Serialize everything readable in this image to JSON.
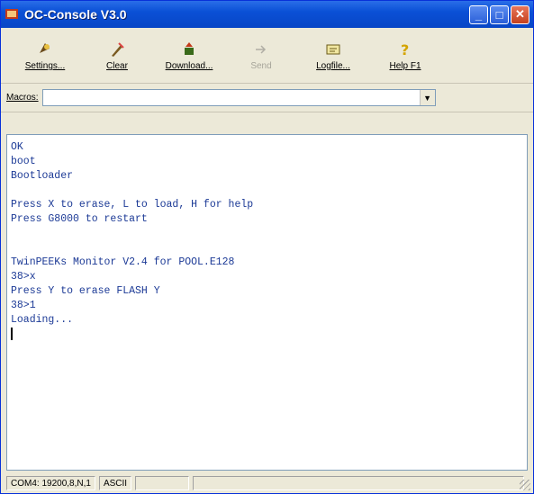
{
  "window": {
    "title": "OC-Console V3.0"
  },
  "toolbar": {
    "items": [
      {
        "label": "Settings...",
        "icon": "settings-icon",
        "enabled": true
      },
      {
        "label": "Clear",
        "icon": "clear-icon",
        "enabled": true
      },
      {
        "label": "Download...",
        "icon": "download-icon",
        "enabled": true
      },
      {
        "label": "Send",
        "icon": "send-icon",
        "enabled": false
      },
      {
        "label": "Logfile...",
        "icon": "logfile-icon",
        "enabled": true
      },
      {
        "label": "Help F1",
        "icon": "help-icon",
        "enabled": true
      }
    ]
  },
  "macros": {
    "label": "Macros:",
    "value": ""
  },
  "console": {
    "lines": [
      "OK",
      "boot",
      "Bootloader",
      "",
      "Press X to erase, L to load, H for help",
      "Press G8000 to restart",
      "",
      "",
      "TwinPEEKs Monitor V2.4 for POOL.E128",
      "38>x",
      "Press Y to erase FLASH Y",
      "38>1",
      "Loading..."
    ],
    "text_color": "#1c3a96"
  },
  "statusbar": {
    "port": "COM4: 19200,8,N,1",
    "mode": "ASCII"
  }
}
